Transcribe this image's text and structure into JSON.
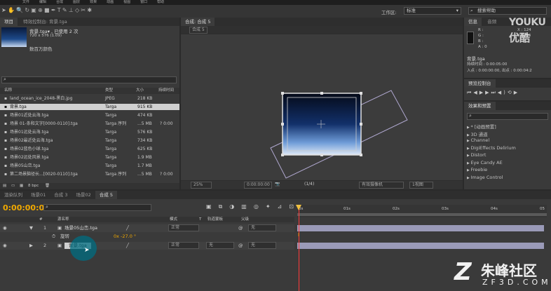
{
  "menu": [
    "文件",
    "编辑",
    "合成",
    "图层",
    "效果",
    "动画",
    "视图",
    "窗口",
    "帮助"
  ],
  "workspace": {
    "label": "工作区:",
    "value": "标准"
  },
  "search_help": {
    "placeholder": "搜索帮助"
  },
  "project": {
    "tab": "项目",
    "effect_controls_tab": "特效控制台: 背景.tga",
    "selected_name": "背景.tga▾ , 已使用 2 次",
    "selected_size": "720 x 576 (1.09)",
    "selected_colors": "数百万颜色",
    "headers": {
      "name": "名称",
      "type": "类型",
      "size": "大小",
      "duration": "持续时间"
    },
    "files": [
      {
        "name": "land_ocean_ice_2048-黑白.jpg",
        "type": "JPEG",
        "size": "218 KB",
        "dur": ""
      },
      {
        "name": "背景.tga",
        "type": "Targa",
        "size": "915 KB",
        "dur": ""
      },
      {
        "name": "场景01近处云海.tga",
        "type": "Targa",
        "size": "474 KB",
        "dur": ""
      },
      {
        "name": "场景 01-条和文字[0000-0110].tga",
        "type": "Targa 序列",
        "size": "...5 MB",
        "dur": "? 0:00"
      },
      {
        "name": "场景01远处云海.tga",
        "type": "Targa",
        "size": "576 KB",
        "dur": ""
      },
      {
        "name": "场景02最近处云海.tga",
        "type": "Targa",
        "size": "734 KB",
        "dur": ""
      },
      {
        "name": "场景02蓝色小球.tga",
        "type": "Targa",
        "size": "625 KB",
        "dur": ""
      },
      {
        "name": "场景02远处风景.tga",
        "type": "Targa",
        "size": "1.9 MB",
        "dur": ""
      },
      {
        "name": "场景05山峦.tga",
        "type": "Targa",
        "size": "1.7 MB",
        "dur": ""
      },
      {
        "name": "第二场景脑径长...[0020-0110].tga",
        "type": "Targa 序列",
        "size": "...5 MB",
        "dur": "? 0:00"
      }
    ],
    "bpc": "8 bpc"
  },
  "comp": {
    "tab": "合成: 合成 5",
    "subtab": "合成 5",
    "zoom": "25%",
    "timecode": "0:00:00:00",
    "resolution": "(1/4)",
    "camera": "有效摄像机",
    "views": "1视图"
  },
  "info": {
    "tab": "信息",
    "audio_tab": "音频",
    "r": "R :",
    "g": "G :",
    "b": "B :",
    "a": "A : 0",
    "x": "X : 124",
    "y": "Y : 384",
    "file": "背景.tga",
    "duration": "持续时间 : 0:00:05:00",
    "inout": "入点 : 0:00:00:00,  出点 : 0:00:04:2"
  },
  "preview": {
    "tab": "预览控制台"
  },
  "effects": {
    "tab": "效果和预置",
    "search_placeholder": "",
    "items": [
      "* [动画预置]",
      "3D 通道",
      "Channel",
      "DigiEffects Delirium",
      "Distort",
      "Eye Candy AE",
      "Freebie",
      "Image Control"
    ]
  },
  "timeline": {
    "tabs": [
      "渲染队列",
      "场景01",
      "合成 3",
      "场景02",
      "合成 5"
    ],
    "timecode": "0:00:00:00",
    "ruler": [
      "0s",
      "01s",
      "02s",
      "03s",
      "04s",
      "05"
    ],
    "headers": {
      "num": "#",
      "source": "源名称",
      "mode": "模式",
      "t": "T",
      "trkmat": "轨道蒙板",
      "parent": "父级"
    },
    "layers": [
      {
        "num": "1",
        "name": "场景05山峦.tga",
        "mode": "正常",
        "trkmat": "",
        "parent": "无"
      },
      {
        "num": "2",
        "name": "背景.tga",
        "mode": "正常",
        "trkmat": "无",
        "parent": "无"
      }
    ],
    "rotation": {
      "label": "旋转",
      "value": "0x -27.0 °"
    }
  },
  "watermark": {
    "youku": "YOUKU",
    "youku_cn": "优酷",
    "brand": "朱峰社区",
    "domain": "ZF3D.COM"
  },
  "colors": {
    "accent": "#f0a800",
    "layer_bar": "#9a9ab8",
    "playhead": "#ff3a3a"
  }
}
